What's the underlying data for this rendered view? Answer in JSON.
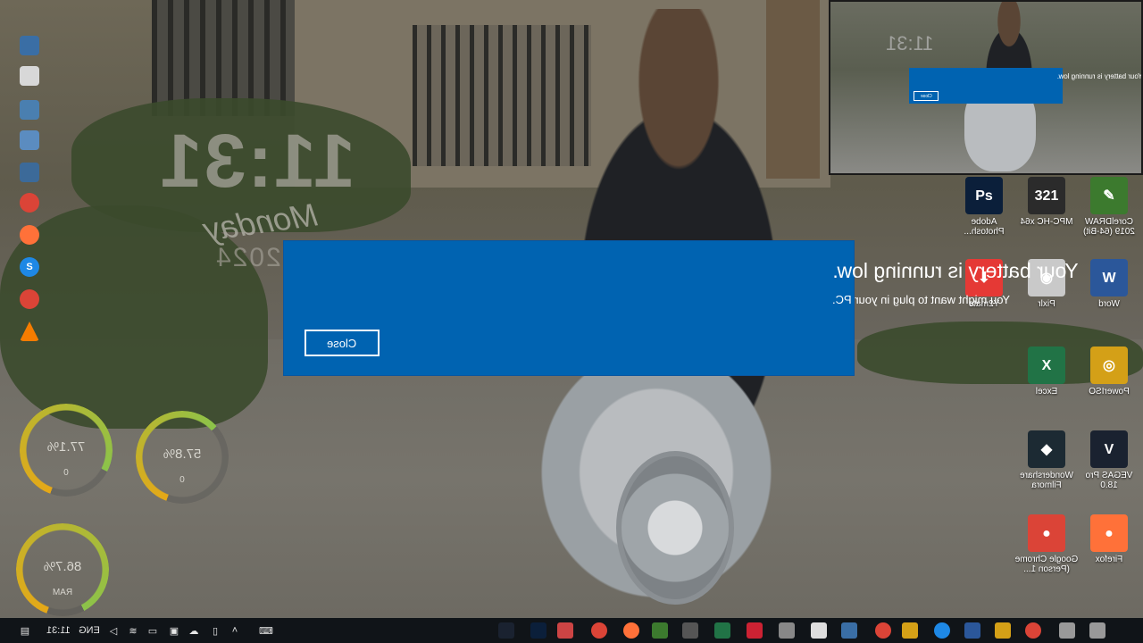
{
  "overlay_clock": {
    "time": "11:31",
    "day": "Monday",
    "date": "1 2024"
  },
  "dialog": {
    "title": "Your battery is running low.",
    "message": "You might want to plug in your PC.",
    "close_label": "Close",
    "color": "#0063b1"
  },
  "preview": {
    "title": "Your battery is running low.",
    "close_label": "Close",
    "clock": "11:31"
  },
  "gauges": [
    {
      "value": "77.1%",
      "label": "0",
      "level": 0.771,
      "color": "#8bc34a"
    },
    {
      "value": "57.8%",
      "label": "0",
      "level": 0.578,
      "color": "#8bc34a"
    },
    {
      "value": "86.7%",
      "label": "RAM",
      "level": 0.867,
      "color": "#8bc34a"
    }
  ],
  "desktop_icons": [
    {
      "label": "Adobe Photosh...",
      "icon": "photoshop-icon",
      "glyph": "Ps",
      "color": "#0b1f3a"
    },
    {
      "label": "MPC-HC x64",
      "icon": "mpc-hc-icon",
      "glyph": "321",
      "color": "#2b2b2b"
    },
    {
      "label": "CorelDRAW 2019 (64-Bit)",
      "icon": "coreldraw-icon",
      "glyph": "✎",
      "color": "#3c7a2e"
    },
    {
      "label": "Y2mate",
      "icon": "y2mate-icon",
      "glyph": "⬇",
      "color": "#e53935"
    },
    {
      "label": "Pixlr",
      "icon": "pixlr-icon",
      "glyph": "◉",
      "color": "#c9c9c9"
    },
    {
      "label": "Word",
      "icon": "word-icon",
      "glyph": "W",
      "color": "#2b579a"
    },
    {
      "label": "Excel",
      "icon": "excel-icon",
      "glyph": "X",
      "color": "#217346"
    },
    {
      "label": "PowerISO",
      "icon": "poweriso-icon",
      "glyph": "◎",
      "color": "#d4a017"
    },
    {
      "label": "Wondershare Filmora",
      "icon": "filmora-icon",
      "glyph": "◆",
      "color": "#1c2a33"
    },
    {
      "label": "VEGAS Pro 18.0",
      "icon": "vegas-icon",
      "glyph": "V",
      "color": "#1a2230"
    },
    {
      "label": "Google Chrome (Person 1...",
      "icon": "chrome-icon",
      "glyph": "●",
      "color": "#db4437"
    },
    {
      "label": "Firefox",
      "icon": "firefox-icon",
      "glyph": "●",
      "color": "#ff7139"
    }
  ],
  "taskbar": {
    "time": "11:31",
    "language": "ENG",
    "pinned_icons": [
      "vegas-icon",
      "photoshop-icon",
      "app-icon",
      "chrome-icon",
      "firefox-icon",
      "photos-icon",
      "settings-icon",
      "excel-icon",
      "app-icon",
      "app-icon",
      "media-icon",
      "folder-icon",
      "chrome-icon",
      "files-icon",
      "edge-icon",
      "l-icon",
      "explorer-icon",
      "chrome-icon",
      "taskview-icon",
      "search-icon"
    ]
  }
}
